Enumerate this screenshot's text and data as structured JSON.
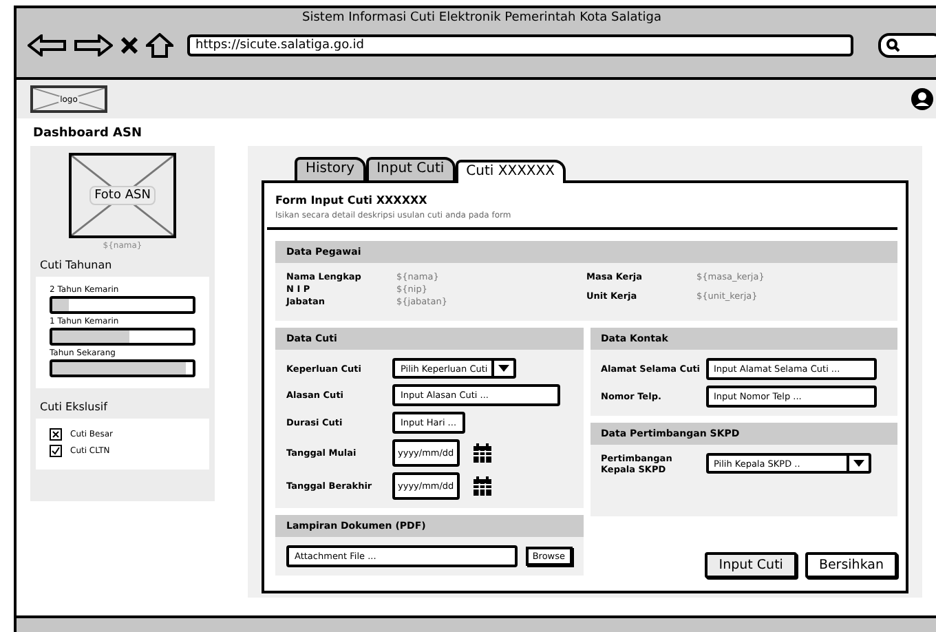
{
  "browser": {
    "title": "Sistem Informasi Cuti Elektronik Pemerintah Kota Salatiga",
    "url": "https://sicute.salatiga.go.id"
  },
  "header": {
    "logo": "logo"
  },
  "page_title": "Dashboard ASN",
  "sidebar": {
    "photo_label": "Foto ASN",
    "name": "${nama}",
    "annual_title": "Cuti Tahunan",
    "annual": [
      {
        "label": "2 Tahun Kemarin",
        "level": 0.12
      },
      {
        "label": "1 Tahun Kemarin",
        "level": 0.55
      },
      {
        "label": "Tahun Sekarang",
        "level": 0.95
      }
    ],
    "exclusive_title": "Cuti Ekslusif",
    "exclusive": [
      {
        "label": "Cuti Besar",
        "kind": "cross"
      },
      {
        "label": "Cuti CLTN",
        "kind": "check"
      }
    ]
  },
  "tabs": [
    {
      "label": "History",
      "selected": false
    },
    {
      "label": "Input Cuti",
      "selected": false
    },
    {
      "label": "Cuti XXXXXX",
      "selected": true
    }
  ],
  "form": {
    "title": "Form Input Cuti XXXXXX",
    "subtitle": "Isikan secara detail deskripsi usulan cuti anda pada form",
    "pegawai": {
      "title": "Data Pegawai",
      "left": [
        {
          "label": "Nama Lengkap",
          "value": "${nama}"
        },
        {
          "label": "N I P",
          "value": "${nip}"
        },
        {
          "label": "Jabatan",
          "value": "${jabatan}"
        }
      ],
      "right": [
        {
          "label": "Masa Kerja",
          "value": "${masa_kerja}"
        },
        {
          "label": "Unit Kerja",
          "value": "${unit_kerja}"
        }
      ]
    },
    "cuti": {
      "title": "Data Cuti",
      "fields": [
        {
          "label": "Keperluan Cuti",
          "kind": "select",
          "placeholder": "Pilih Keperluan Cuti"
        },
        {
          "label": "Alasan Cuti",
          "kind": "text",
          "placeholder": "Input Alasan Cuti ..."
        },
        {
          "label": "Durasi Cuti",
          "kind": "short",
          "placeholder": "Input Hari ..."
        },
        {
          "label": "Tanggal Mulai",
          "kind": "date",
          "placeholder": "yyyy/mm/dd"
        },
        {
          "label": "Tanggal Berakhir",
          "kind": "date",
          "placeholder": "yyyy/mm/dd"
        }
      ]
    },
    "kontak": {
      "title": "Data Kontak",
      "fields": [
        {
          "label": "Alamat Selama Cuti",
          "kind": "text",
          "placeholder": "Input Alamat Selama Cuti ..."
        },
        {
          "label": "Nomor Telp.",
          "kind": "text",
          "placeholder": "Input Nomor Telp ..."
        }
      ]
    },
    "skpd": {
      "title": "Data Pertimbangan SKPD",
      "fields": [
        {
          "label": "Pertimbangan Kepala SKPD",
          "kind": "select",
          "placeholder": "Pilih Kepala SKPD .."
        }
      ]
    },
    "lampiran": {
      "title": "Lampiran Dokumen (PDF)",
      "placeholder": "Attachment File ...",
      "browse": "Browse"
    },
    "buttons": [
      "Input Cuti",
      "Bersihkan"
    ]
  }
}
